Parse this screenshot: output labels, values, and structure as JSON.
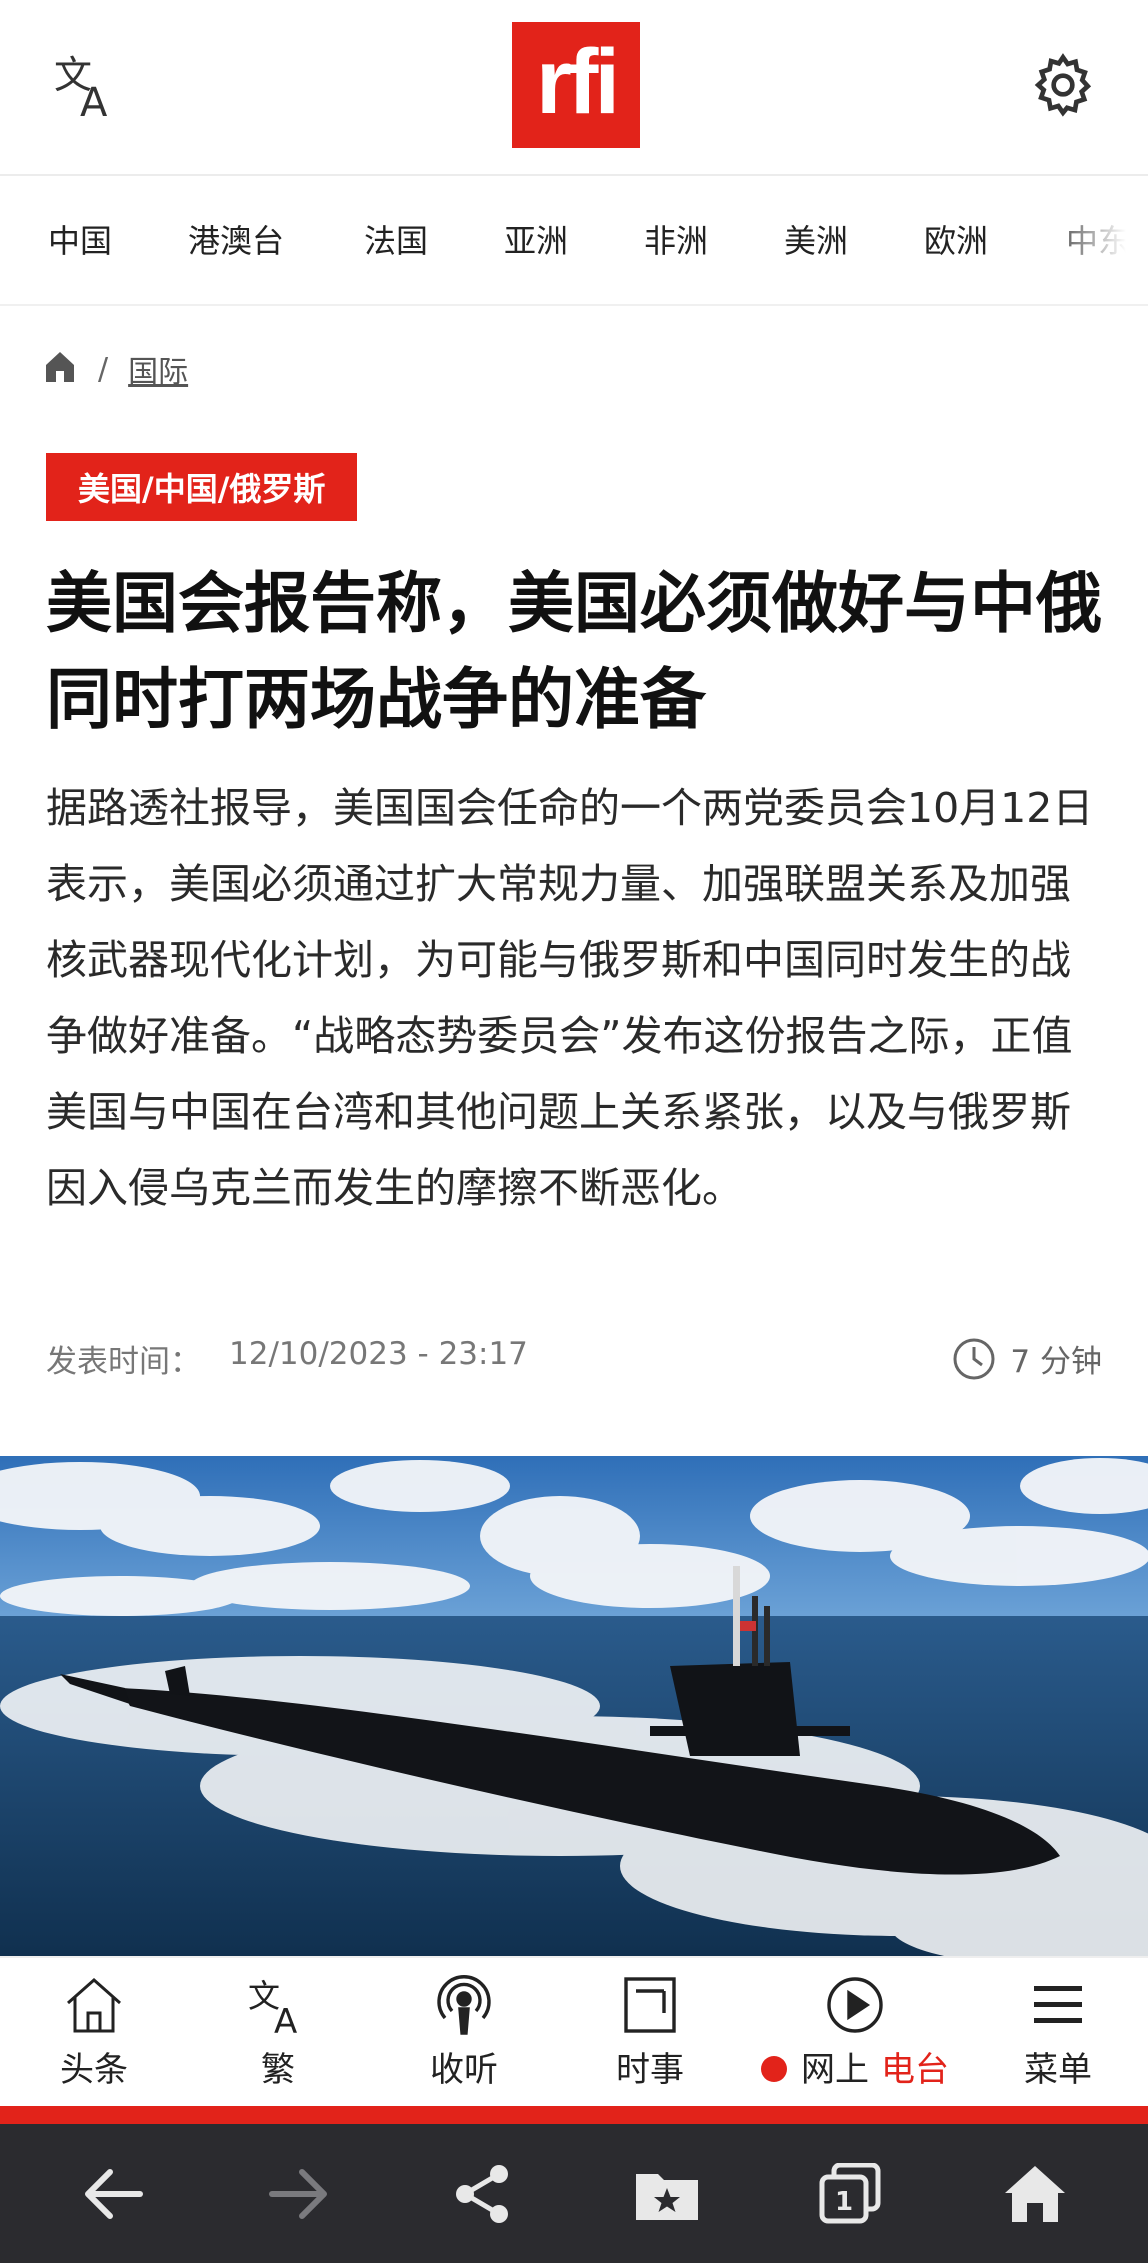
{
  "header": {
    "logo_text": "rfi",
    "brand_color": "#e2231a"
  },
  "nav": {
    "items": [
      "中国",
      "港澳台",
      "法国",
      "亚洲",
      "非洲",
      "美洲",
      "欧洲",
      "中东"
    ]
  },
  "breadcrumb": {
    "separator": "/",
    "section": "国际"
  },
  "article": {
    "tag": "美国/中国/俄罗斯",
    "title": "美国会报告称，美国必须做好与中俄同时打两场战争的准备",
    "summary": "据路透社报导，美国国会任命的一个两党委员会10月12日表示，美国必须通过扩大常规力量、加强联盟关系及加强核武器现代化计划，为可能与俄罗斯和中国同时发生的战争做好准备。“战略态势委员会”发布这份报告之际，正值美国与中国在台湾和其他问题上关系紧张，以及与俄罗斯因入侵乌克兰而发生的摩擦不断恶化。",
    "published_label": "发表时间：",
    "published_value": "12/10/2023 - 23:17",
    "read_time": "7 分钟"
  },
  "tabbar": {
    "headlines": "头条",
    "traditional": "繁",
    "listen": "收听",
    "current_affairs": "时事",
    "online": "网上",
    "radio": "电台",
    "menu": "菜单"
  },
  "icons": {
    "translate": "translate-icon",
    "settings": "gear-icon",
    "home": "home-icon",
    "clock": "clock-icon",
    "podcast": "podcast-icon",
    "news": "newspaper-icon",
    "play": "play-icon",
    "menu": "hamburger-icon",
    "back": "arrow-left-icon",
    "forward": "arrow-right-icon",
    "share": "share-icon",
    "bookmarks": "bookmark-folder-icon",
    "tabs": "tabs-icon",
    "browser_home": "home-icon"
  },
  "system": {
    "tab_count": "1"
  }
}
